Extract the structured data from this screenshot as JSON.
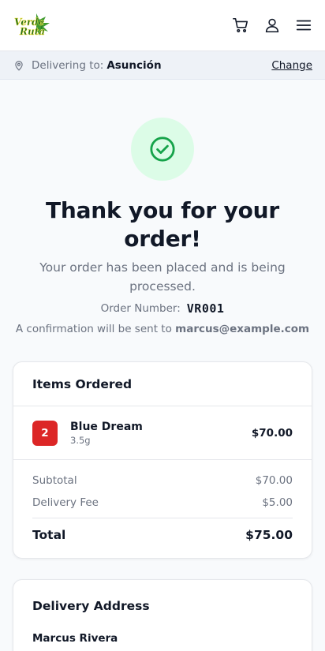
{
  "header": {
    "logo_text": [
      "Verde",
      "Ruta"
    ],
    "icons": [
      "cart-icon",
      "user-icon",
      "menu-icon"
    ]
  },
  "delivery": {
    "label": "Delivering to:",
    "city": "Asunción",
    "change": "Change"
  },
  "confirmation": {
    "title": "Thank you for your order!",
    "subtitle": "Your order has been placed and is being processed.",
    "order_number_label": "Order Number:",
    "order_number": "VR001",
    "confirm_prefix": "A confirmation will be sent to",
    "email": "marcus@example.com"
  },
  "items_card": {
    "title": "Items Ordered",
    "items": [
      {
        "qty": "2",
        "name": "Blue Dream",
        "size": "3.5g",
        "price": "$70.00"
      }
    ],
    "subtotal_label": "Subtotal",
    "subtotal": "$70.00",
    "delivery_fee_label": "Delivery Fee",
    "delivery_fee": "$5.00",
    "total_label": "Total",
    "total": "$75.00"
  },
  "address_card": {
    "title": "Delivery Address",
    "name": "Marcus Rivera"
  },
  "colors": {
    "accent_green": "#16a34a",
    "success_bg": "#dcfce7",
    "badge_red": "#dc2626"
  }
}
